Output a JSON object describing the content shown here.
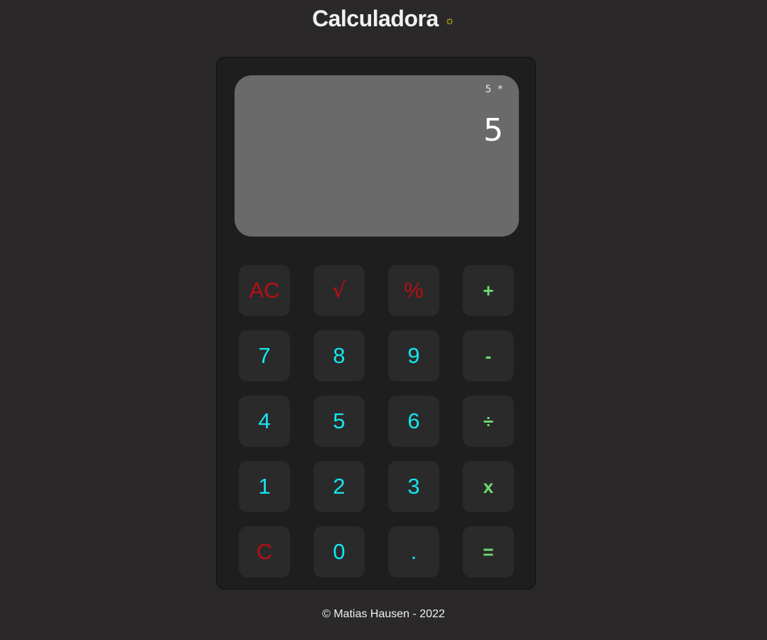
{
  "header": {
    "title": "Calculadora",
    "theme_icon": "☼"
  },
  "display": {
    "expression": "5 *",
    "result": "5"
  },
  "keys": [
    [
      "AC",
      "√",
      "%",
      "+"
    ],
    [
      "7",
      "8",
      "9",
      "-"
    ],
    [
      "4",
      "5",
      "6",
      "÷"
    ],
    [
      "1",
      "2",
      "3",
      "x"
    ],
    [
      "C",
      "0",
      ".",
      "="
    ]
  ],
  "key_colors": {
    "function": "#b50f13",
    "digit": "#14e6ef",
    "operator": "#6fdc6f"
  },
  "footer": {
    "text": "© Matias Hausen - 2022"
  }
}
